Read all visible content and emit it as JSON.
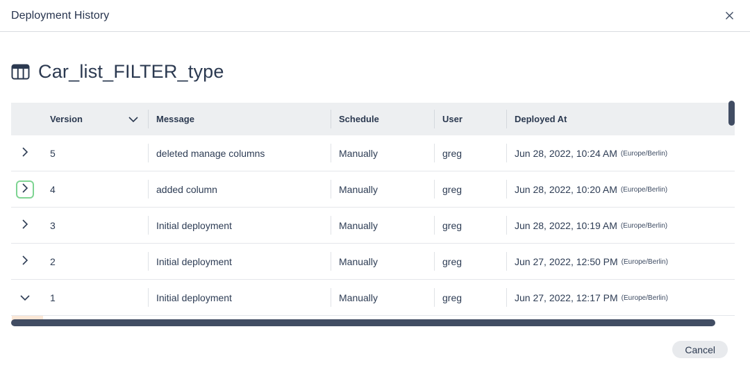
{
  "modal": {
    "title": "Deployment History",
    "cancel_label": "Cancel"
  },
  "page": {
    "heading": "Car_list_FILTER_type",
    "heading_icon": "table-icon"
  },
  "table": {
    "columns": {
      "version": "Version",
      "message": "Message",
      "schedule": "Schedule",
      "user": "User",
      "deployed_at": "Deployed At"
    },
    "rows": [
      {
        "version": "5",
        "message": "deleted manage columns",
        "schedule": "Manually",
        "user": "greg",
        "deployed_at": "Jun 28, 2022, 10:24 AM",
        "timezone": "(Europe/Berlin)",
        "state": "collapsed",
        "focused": false
      },
      {
        "version": "4",
        "message": "added column",
        "schedule": "Manually",
        "user": "greg",
        "deployed_at": "Jun 28, 2022, 10:20 AM",
        "timezone": "(Europe/Berlin)",
        "state": "collapsed",
        "focused": true
      },
      {
        "version": "3",
        "message": "Initial deployment",
        "schedule": "Manually",
        "user": "greg",
        "deployed_at": "Jun 28, 2022, 10:19 AM",
        "timezone": "(Europe/Berlin)",
        "state": "collapsed",
        "focused": false
      },
      {
        "version": "2",
        "message": "Initial deployment",
        "schedule": "Manually",
        "user": "greg",
        "deployed_at": "Jun 27, 2022, 12:50 PM",
        "timezone": "(Europe/Berlin)",
        "state": "collapsed",
        "focused": false
      },
      {
        "version": "1",
        "message": "Initial deployment",
        "schedule": "Manually",
        "user": "greg",
        "deployed_at": "Jun 27, 2022, 12:17 PM",
        "timezone": "(Europe/Berlin)",
        "state": "expanded",
        "focused": false
      }
    ]
  },
  "colors": {
    "text_navy": "#2d3c54",
    "header_bg": "#edeff1",
    "scrollbar": "#414d63",
    "focus_ring_green": "#7ed492",
    "diff_removed_peach": "#fbe7d6",
    "cancel_bg": "#e8eaed"
  }
}
